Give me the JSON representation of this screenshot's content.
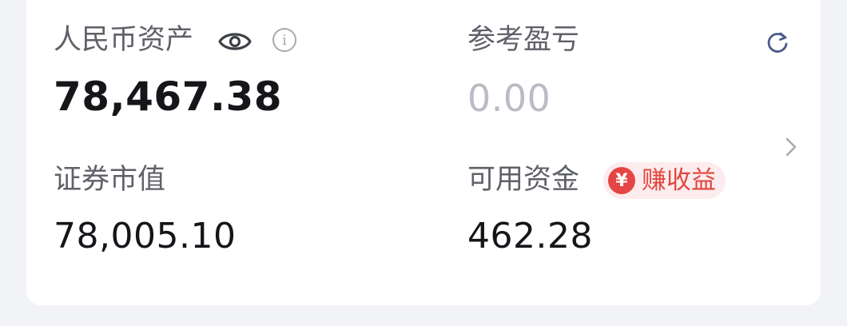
{
  "rmb_assets": {
    "label": "人民币资产",
    "value": "78,467.38",
    "eye_icon": "eye-icon",
    "info_icon": "info-icon",
    "info_glyph": "i"
  },
  "reference_pl": {
    "label": "参考盈亏",
    "value": "0.00",
    "refresh_icon": "refresh-icon"
  },
  "market_value": {
    "label": "证券市值",
    "value": "78,005.10"
  },
  "available_funds": {
    "label": "可用资金",
    "value": "462.28"
  },
  "earn_badge": {
    "coin_glyph": "¥",
    "label": "赚收益",
    "accent": "#e64545",
    "bg": "#fdeced"
  },
  "nav": {
    "chevron_icon": "chevron-right-icon"
  }
}
